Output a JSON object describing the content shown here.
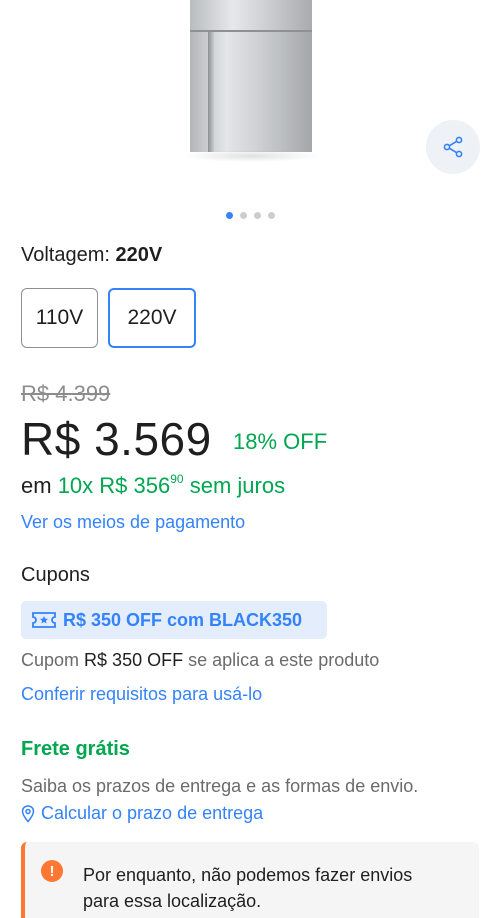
{
  "product": {
    "image_alt": "stainless-steel-refrigerator",
    "gallery_dots": 4,
    "active_dot": 1
  },
  "share": {
    "icon": "share-icon"
  },
  "voltage": {
    "label": "Voltagem:",
    "selected": "220V",
    "options": [
      "110V",
      "220V"
    ]
  },
  "price": {
    "original": "R$ 4.399",
    "current": "R$ 3.569",
    "discount": "18% OFF",
    "installments_prefix": "em",
    "installments_count": "10x",
    "installment_value": "R$ 356",
    "installment_cents": "90",
    "installments_suffix": "sem juros",
    "payment_methods_link": "Ver os meios de pagamento"
  },
  "coupons": {
    "title": "Cupons",
    "badge": "R$ 350 OFF com BLACK350",
    "info_prefix": "Cupom",
    "info_amount": "R$ 350 OFF",
    "info_suffix": "se aplica a este produto",
    "requirements_link": "Conferir requisitos para usá-lo"
  },
  "shipping": {
    "title": "Frete grátis",
    "description": "Saiba os prazos de entrega e as formas de envio.",
    "calculate_link": "Calcular o prazo de entrega"
  },
  "alert": {
    "icon": "!",
    "message": "Por enquanto, não podemos fazer envios para essa localização."
  },
  "colors": {
    "accent": "#3483fa",
    "green": "#00a650",
    "warning": "#ff7733"
  }
}
